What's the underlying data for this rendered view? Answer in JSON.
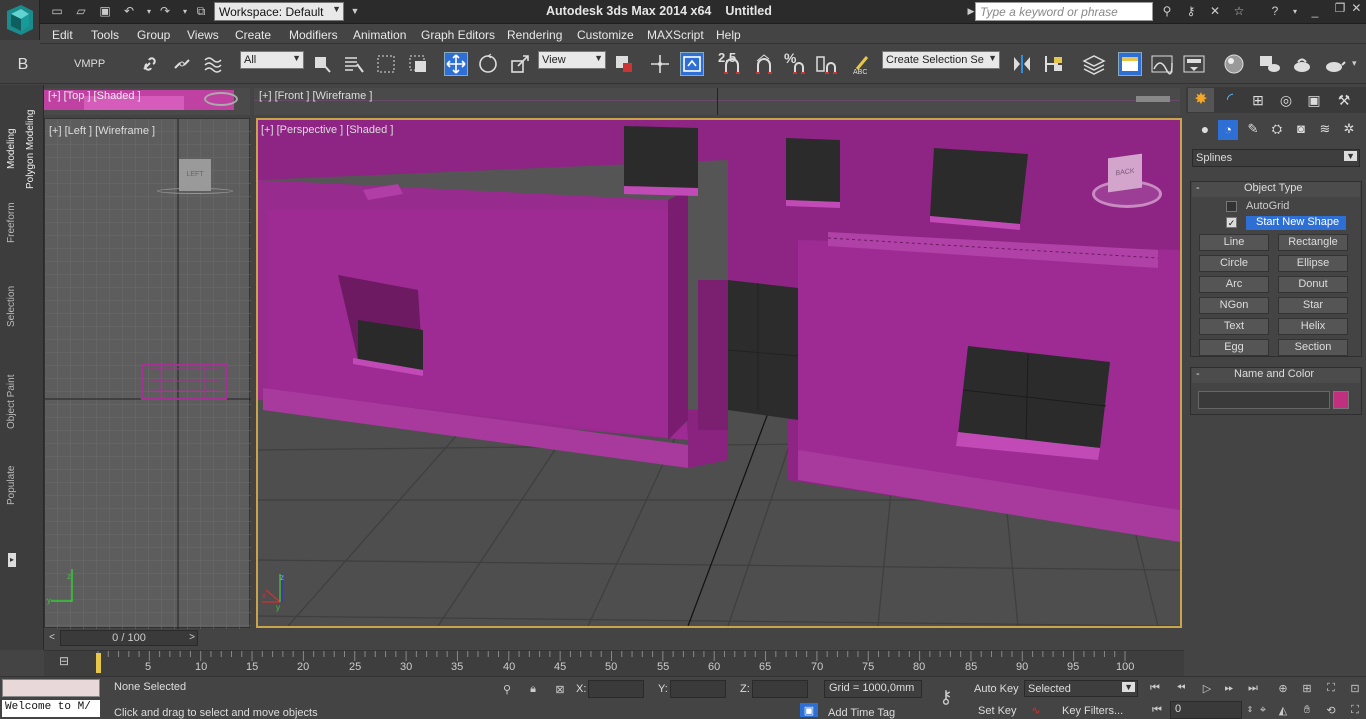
{
  "app": {
    "title": "Autodesk 3ds Max  2014 x64",
    "document": "Untitled",
    "workspace": "Workspace: Default",
    "search_placeholder": "Type a keyword or phrase"
  },
  "menu": [
    "Edit",
    "Tools",
    "Group",
    "Views",
    "Create",
    "Modifiers",
    "Animation",
    "Graph Editors",
    "Rendering",
    "Customize",
    "MAXScript",
    "Help"
  ],
  "toolbar": {
    "vmpp_label": "VMPP",
    "filter_value": "All",
    "refcoord_value": "View",
    "snap_angle": "2.5",
    "snap_percent": "%",
    "selection_set_value": "Create Selection Se"
  },
  "ribbon_tabs": [
    "Modeling",
    "Polygon Modeling",
    "Freeform",
    "Selection",
    "Object Paint",
    "Populate"
  ],
  "viewports": {
    "top": "[+] [Top ] [Shaded ]",
    "front": "[+] [Front ] [Wireframe ]",
    "left": "[+] [Left ] [Wireframe ]",
    "perspective": "[+] [Perspective ] [Shaded ]",
    "viewcube_left": "LEFT",
    "viewcube_back": "BACK"
  },
  "command_panel": {
    "category": "Splines",
    "object_type_title": "Object Type",
    "autogrid_label": "AutoGrid",
    "start_new_shape_label": "Start New Shape",
    "buttons": [
      "Line",
      "Rectangle",
      "Circle",
      "Ellipse",
      "Arc",
      "Donut",
      "NGon",
      "Star",
      "Text",
      "Helix",
      "Egg",
      "Section"
    ],
    "name_color_title": "Name and Color",
    "object_color": "#c0307f"
  },
  "timeline": {
    "frame_display": "0 / 100",
    "ticks": [
      "5",
      "10",
      "15",
      "20",
      "25",
      "30",
      "35",
      "40",
      "45",
      "50",
      "55",
      "60",
      "65",
      "70",
      "75",
      "80",
      "85",
      "90",
      "95",
      "100"
    ]
  },
  "status": {
    "maxscript": "Welcome to M/",
    "selection": "None Selected",
    "prompt": "Click and drag to select and move objects",
    "x_label": "X:",
    "y_label": "Y:",
    "z_label": "Z:",
    "grid": "Grid = 1000,0mm",
    "add_time_tag": "Add Time Tag",
    "auto_key": "Auto Key",
    "set_key": "Set Key",
    "key_mode": "Selected",
    "key_filters": "Key Filters...",
    "current_frame": "0"
  },
  "colors": {
    "magenta": "#9b2b8b",
    "viewport_border": "#c8a44a",
    "selection_blue": "#2e6fd6"
  }
}
